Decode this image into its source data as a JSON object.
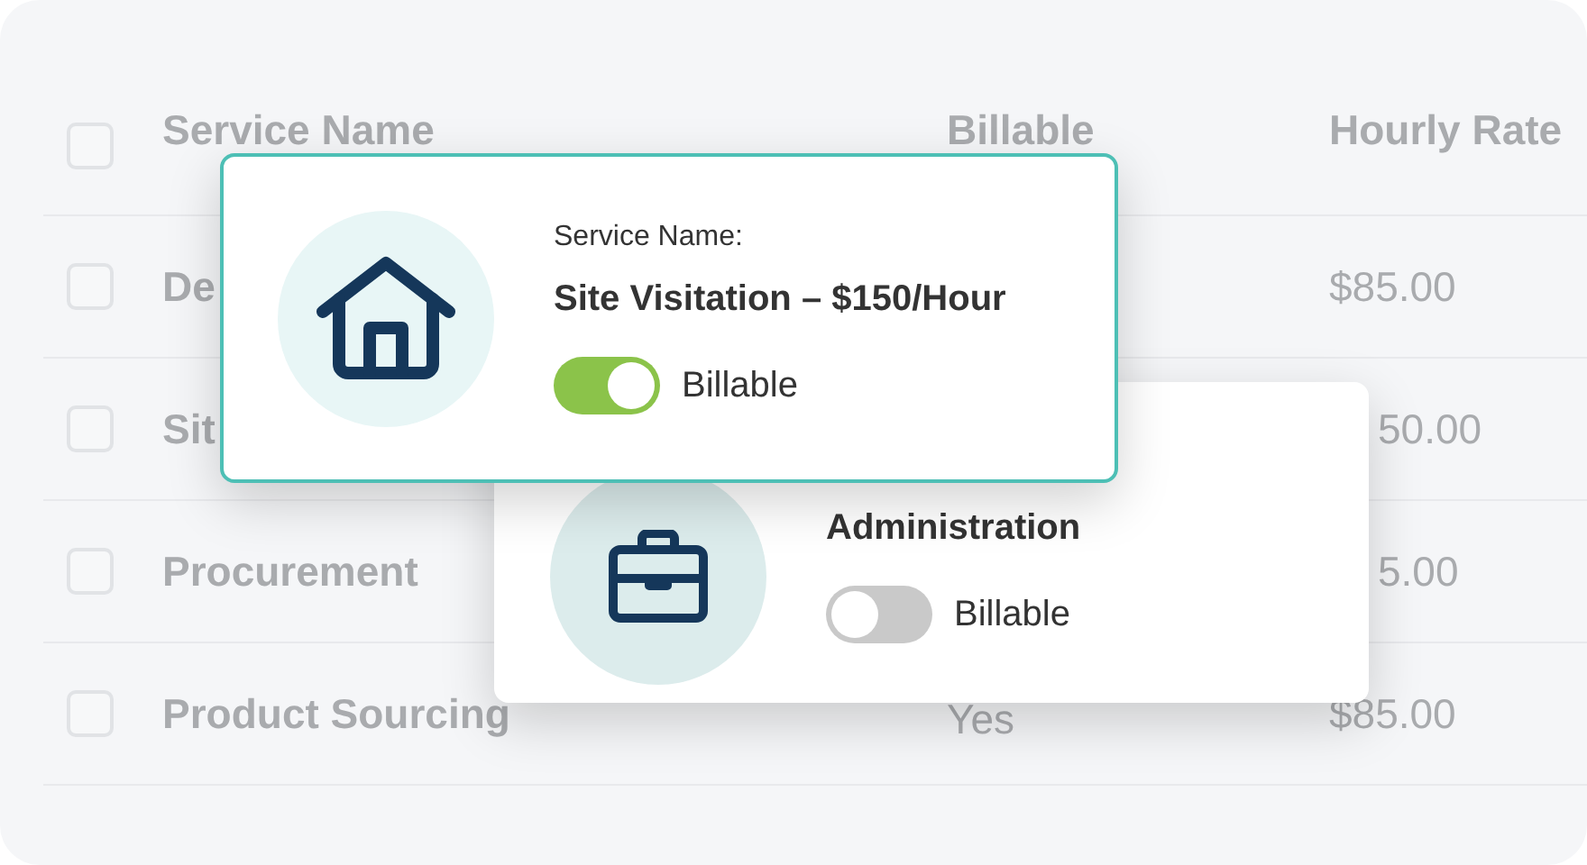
{
  "table": {
    "header_checked": false,
    "columns": [
      "Service Name",
      "Billable",
      "Hourly Rate"
    ],
    "rows": [
      {
        "checked": false,
        "service": "De",
        "rate": "$85.00"
      },
      {
        "checked": false,
        "service": "Sit",
        "rate": "50.00"
      },
      {
        "checked": false,
        "service": "Procurement",
        "rate": "5.00"
      },
      {
        "checked": false,
        "service": "Product Sourcing",
        "billable": "Yes",
        "rate": "$85.00"
      }
    ]
  },
  "cards": [
    {
      "selected": true,
      "label": "Service Name:",
      "title": "Site Visitation – $150/Hour",
      "toggle_label": "Billable",
      "on": true
    },
    {
      "selected": false,
      "title": "Administration",
      "toggle_label": "Billable",
      "on": false
    }
  ]
}
